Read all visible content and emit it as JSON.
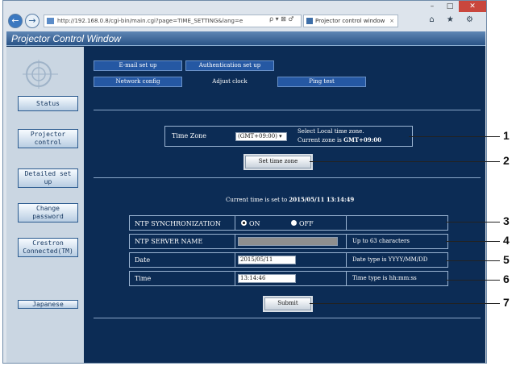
{
  "browser": {
    "url": "http://192.168.0.8/cgi-bin/main.cgi?page=TIME_SETTING&lang=e",
    "tab_title": "Projector control window",
    "tab_close": "×",
    "back": "←",
    "forward": "→",
    "url_tools": "ρ ▾ ⊠ ♂",
    "right_icons": "⌂ ★ ⚙",
    "minimize": "–",
    "maximize": "□",
    "close": "✕"
  },
  "page": {
    "title": "Projector Control Window"
  },
  "sidebar": {
    "items": [
      {
        "label": "Status"
      },
      {
        "label": "Projector control"
      },
      {
        "label": "Detailed set up"
      },
      {
        "label": "Change password"
      },
      {
        "label": "Crestron Connected(TM)"
      },
      {
        "label": "Japanese"
      }
    ]
  },
  "tabs": {
    "email": "E-mail set up",
    "auth": "Authentication set up",
    "network": "Network config",
    "clock": "Adjust clock",
    "ping": "Ping test"
  },
  "timezone": {
    "label": "Time Zone",
    "value": "(GMT+09:00) ▾",
    "hint_line1": "Select Local time zone.",
    "hint_line2_prefix": "Current zone is ",
    "current_zone": "GMT+09:00",
    "set_button": "Set time zone"
  },
  "clock": {
    "current_prefix": "Current time is set to ",
    "current_time": "2015/05/11 13:14:49"
  },
  "ntp": {
    "sync_label": "NTP SYNCHRONIZATION",
    "on_label": "ON",
    "off_label": "OFF",
    "sync_on": true,
    "server_label": "NTP SERVER NAME",
    "server_value": "",
    "server_hint": "Up to 63 characters",
    "date_label": "Date",
    "date_value": "2015/05/11",
    "date_hint": "Date type is YYYY/MM/DD",
    "time_label": "Time",
    "time_value": "13:14:46",
    "time_hint": "Time type is hh:mm:ss",
    "submit": "Submit"
  },
  "callouts": [
    "1",
    "2",
    "3",
    "4",
    "5",
    "6",
    "7"
  ]
}
